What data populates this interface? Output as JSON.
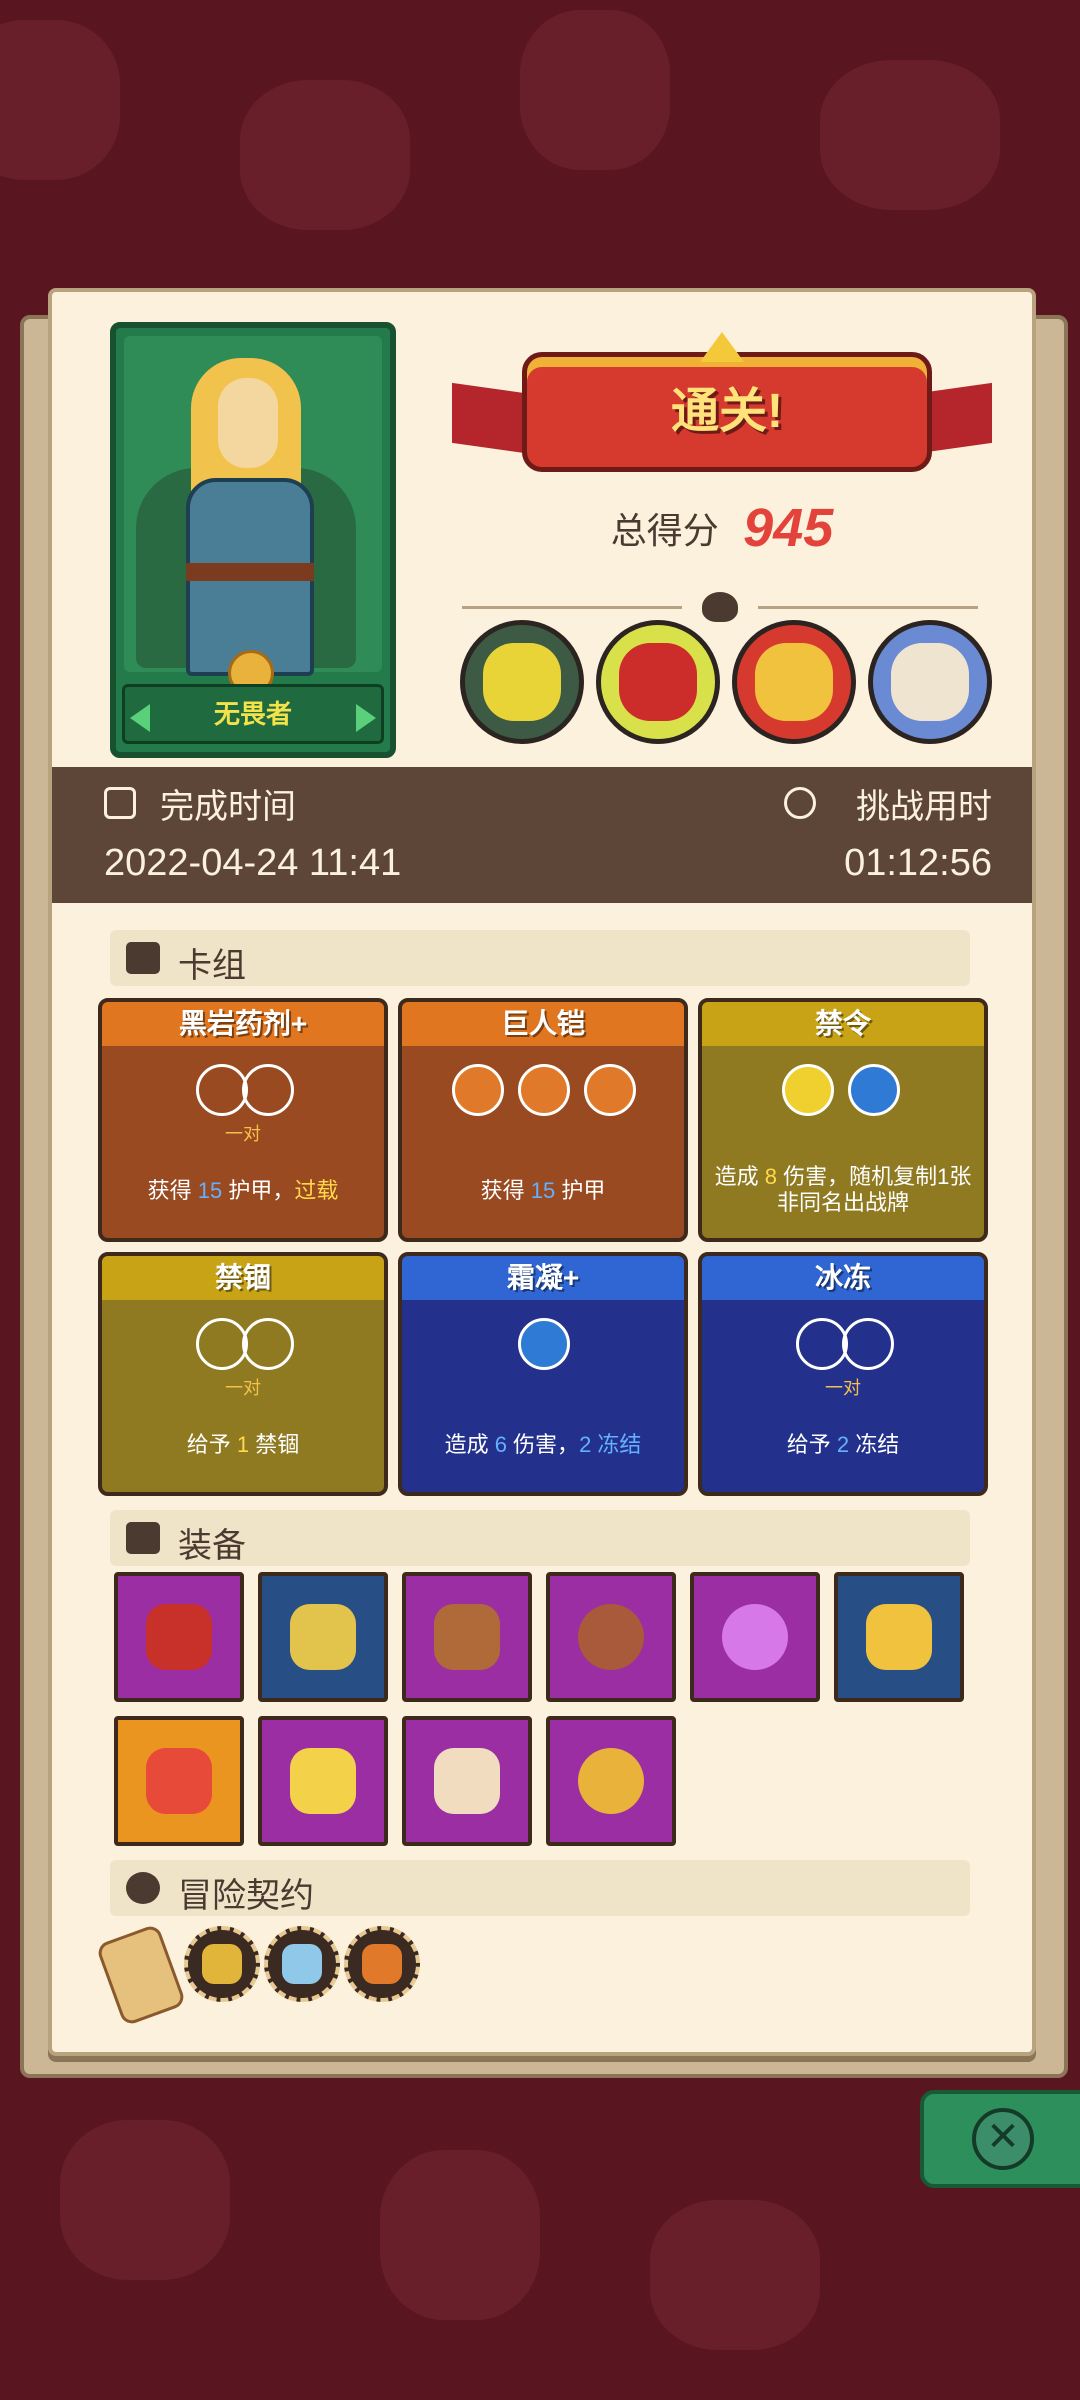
{
  "result": {
    "banner": "通关!",
    "score_label": "总得分",
    "score_value": "945",
    "hero_name": "无畏者"
  },
  "stats": {
    "finish_label": "完成时间",
    "finish_value": "2022-04-24 11:41",
    "duration_label": "挑战用时",
    "duration_value": "01:12:56"
  },
  "deck": {
    "title": "卡组",
    "cards": [
      {
        "name": "黑岩药剂+",
        "pair": "一对",
        "desc_a": "获得 ",
        "num": "15",
        "desc_b": " 护甲，",
        "desc_c": "过载"
      },
      {
        "name": "巨人铠",
        "pair": "",
        "desc_a": "获得 ",
        "num": "15",
        "desc_b": " 护甲",
        "desc_c": ""
      },
      {
        "name": "禁令",
        "pair": "",
        "desc_a": "造成 ",
        "num": "8",
        "desc_b": " 伤害，随机复制1张非同名出战牌",
        "desc_c": ""
      },
      {
        "name": "禁锢",
        "pair": "一对",
        "desc_a": "给予 ",
        "num": "1",
        "desc_b": " 禁锢",
        "desc_c": ""
      },
      {
        "name": "霜凝+",
        "pair": "",
        "desc_a": "造成 ",
        "num": "6",
        "desc_b": " 伤害，",
        "desc_c": "2 冻结"
      },
      {
        "name": "冰冻",
        "pair": "一对",
        "desc_a": "给予 ",
        "num": "2",
        "desc_b": " 冻结",
        "desc_c": ""
      }
    ]
  },
  "equipment": {
    "title": "装备",
    "items": [
      "red-bracer-icon",
      "armor-chest-icon",
      "leather-pauldron-icon",
      "round-shield-icon",
      "purple-potion-icon",
      "treasure-island-icon",
      "phoenix-feather-icon",
      "cheese-wedge-icon",
      "spiked-meat-icon",
      "emerald-ring-icon"
    ]
  },
  "contracts": {
    "title": "冒险契约",
    "items": [
      "hammer-contract-icon",
      "ice-tag-contract-icon",
      "roast-meat-contract-icon"
    ]
  },
  "colors": {
    "panel": "#fbf1dc",
    "accent_red": "#e2443b",
    "band": "#5d4638"
  }
}
